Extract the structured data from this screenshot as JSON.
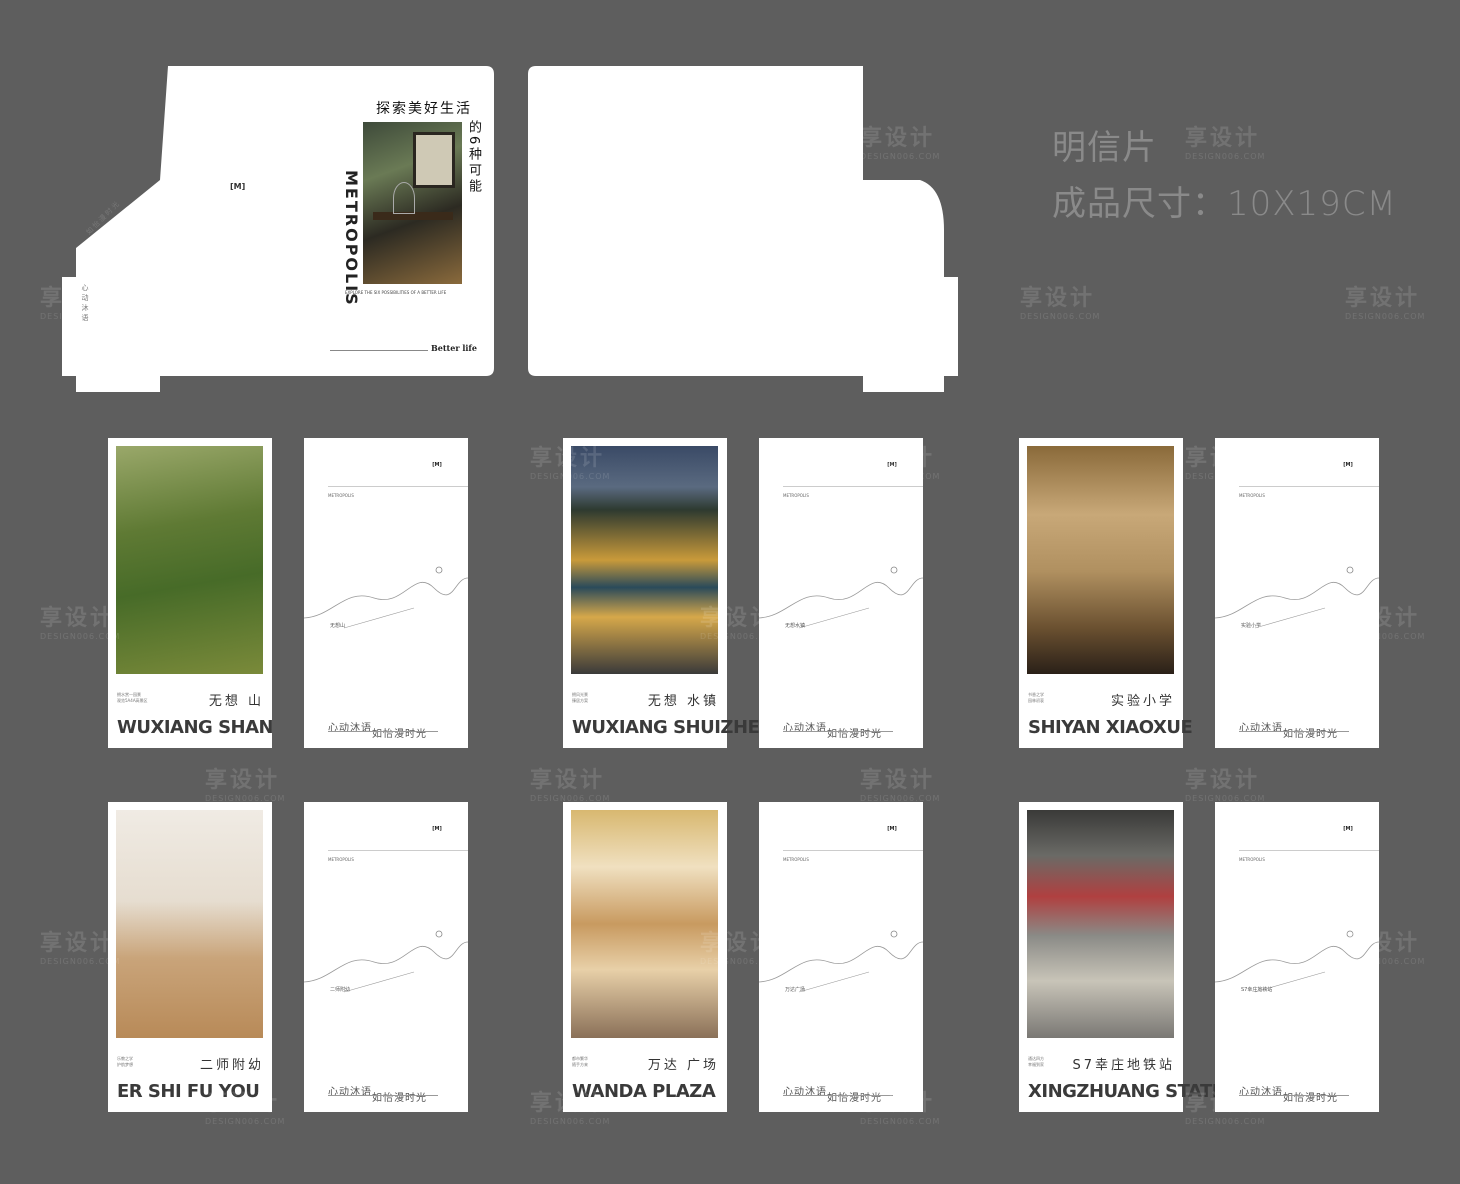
{
  "spec": {
    "line1": "明信片",
    "line2": "成品尺寸：10X19CM"
  },
  "cover": {
    "headline_1": "探索美好生活",
    "headline_2": "的6种可能",
    "brand": "METROPOLIS",
    "subtitle": "EXPLORE THE SIX POSSIBILITIES OF A BETTER LIFE",
    "better_life": "Better life",
    "flap_text": "如怡漫时光",
    "flap_text_2": "心动沐语",
    "logo": "[M]"
  },
  "cards": [
    {
      "cn": "无想 山",
      "en": "WUXIANG SHAN",
      "tiny": "拥水赏一园景\n观览5A4A高景区",
      "route_label": "无想山",
      "scene": "forest"
    },
    {
      "cn": "无想 水镇",
      "en": "WUXIANG SHUIZHEN",
      "tiny": "拥风光景\n臻居方案",
      "route_label": "无想水镇",
      "scene": "town"
    },
    {
      "cn": "实验小学",
      "en": "SHIYAN XIAOXUE",
      "tiny": "书香之学\n园林初衷",
      "route_label": "实验小学",
      "scene": "study"
    },
    {
      "cn": "二师附幼",
      "en": "ER SHI FU YOU",
      "tiny": "乐教之学\n护航梦想",
      "route_label": "二师附幼",
      "scene": "classroom"
    },
    {
      "cn": "万达 广场",
      "en": "WANDA PLAZA",
      "tiny": "都市繁华\n随手方来",
      "route_label": "万达广场",
      "scene": "mall"
    },
    {
      "cn": "S7幸庄地铁站",
      "en": "XINGZHUANG STATION",
      "tiny": "通达四方\n幸福到家",
      "route_label": "S7幸庄地铁站",
      "scene": "metro"
    }
  ],
  "back": {
    "metro": "METROPOLIS",
    "slogan_1": "心动沐语",
    "slogan_2": "如怡漫时光",
    "logo": "[M]"
  },
  "watermark": {
    "text": "享设计",
    "sub": "DESIGN006.COM"
  },
  "colors": {
    "background": "#5e5e5e",
    "paper": "#ffffff",
    "metro_red": "#c23a2e"
  }
}
